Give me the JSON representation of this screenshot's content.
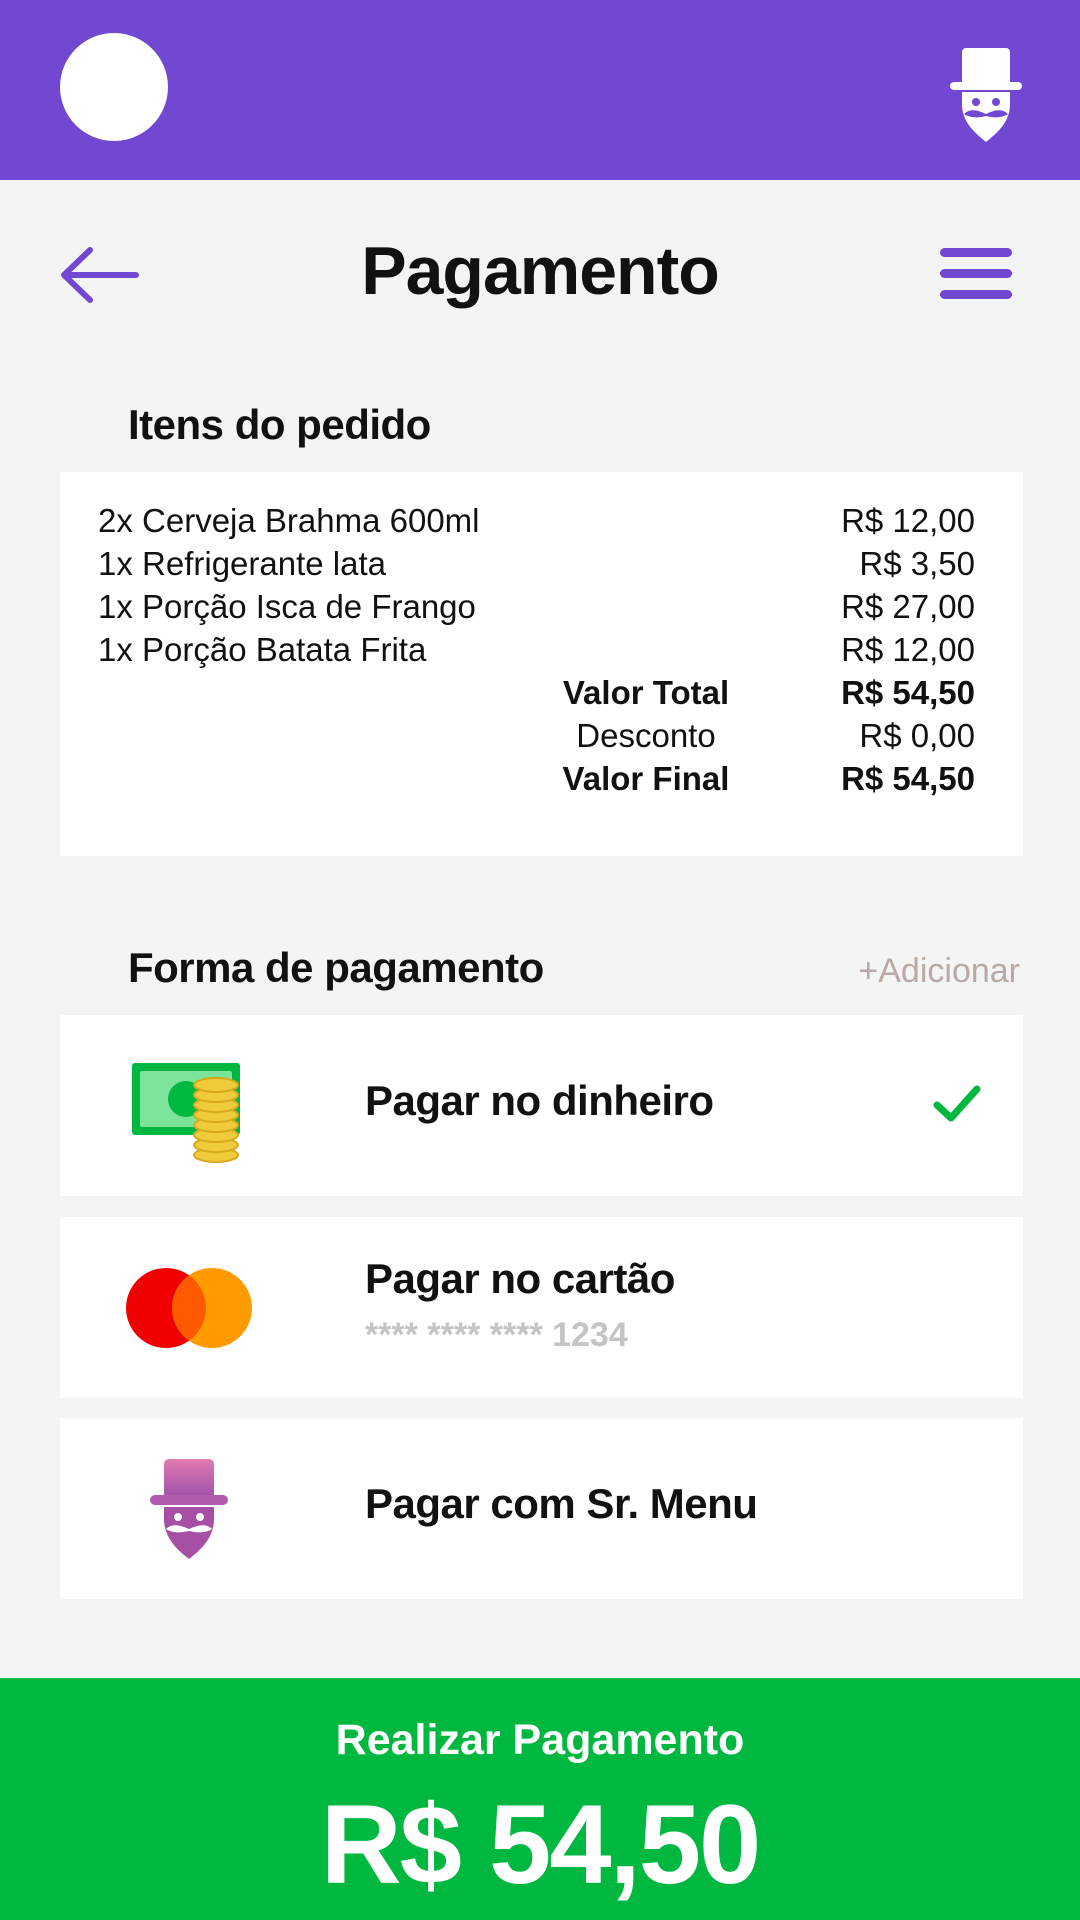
{
  "colors": {
    "primary": "#7148d1",
    "success": "#00b740",
    "background": "#f4f4f4"
  },
  "header": {
    "avatar_icon": "avatar-icon",
    "brand_icon": "sr-menu-mascot-icon"
  },
  "nav": {
    "title": "Pagamento",
    "back_icon": "arrow-left-icon",
    "menu_icon": "hamburger-menu-icon"
  },
  "order": {
    "section_title": "Itens do pedido",
    "items": [
      {
        "name": "2x Cerveja Brahma 600ml",
        "price": "R$ 12,00"
      },
      {
        "name": "1x Refrigerante lata",
        "price": "R$ 3,50"
      },
      {
        "name": "1x Porção Isca de Frango",
        "price": "R$ 27,00"
      },
      {
        "name": "1x Porção Batata Frita",
        "price": "R$ 12,00"
      }
    ],
    "summary": [
      {
        "label": "Valor Total",
        "value": "R$ 54,50",
        "bold": true
      },
      {
        "label": "Desconto",
        "value": "R$ 0,00",
        "bold": false
      },
      {
        "label": "Valor Final",
        "value": "R$ 54,50",
        "bold": true
      }
    ]
  },
  "payment": {
    "section_title": "Forma de pagamento",
    "add_label": "+Adicionar",
    "options": [
      {
        "label": "Pagar no dinheiro",
        "icon": "cash-icon",
        "selected": true
      },
      {
        "label": "Pagar no cartão",
        "icon": "mastercard-icon",
        "card_number": "**** **** **** 1234",
        "selected": false
      },
      {
        "label": "Pagar com Sr. Menu",
        "icon": "sr-menu-icon",
        "selected": false
      }
    ]
  },
  "cta": {
    "label": "Realizar Pagamento",
    "amount": "R$ 54,50"
  }
}
